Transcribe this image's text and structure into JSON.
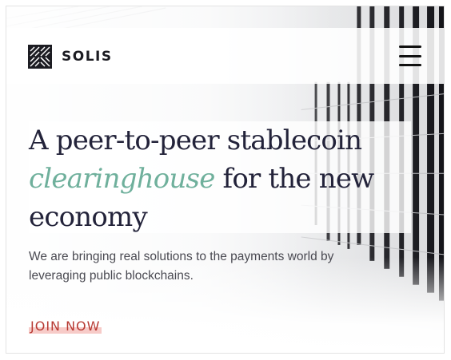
{
  "brand": {
    "name": "SOLIS",
    "logo_icon": "woven-square-logo-icon"
  },
  "header": {
    "menu_icon": "hamburger-menu-icon"
  },
  "hero": {
    "headline_line1": "A peer-to-peer stablecoin",
    "headline_accent": "clearinghouse",
    "headline_rest": " for the new economy",
    "subtext": "We are bringing real solutions to the payments world by leveraging public blockchains.",
    "cta_label": "JOIN NOW"
  },
  "colors": {
    "accent": "#6fb09c",
    "heading": "#23233a",
    "cta": "#b73b34",
    "cta_highlight": "#f7cbc8"
  }
}
